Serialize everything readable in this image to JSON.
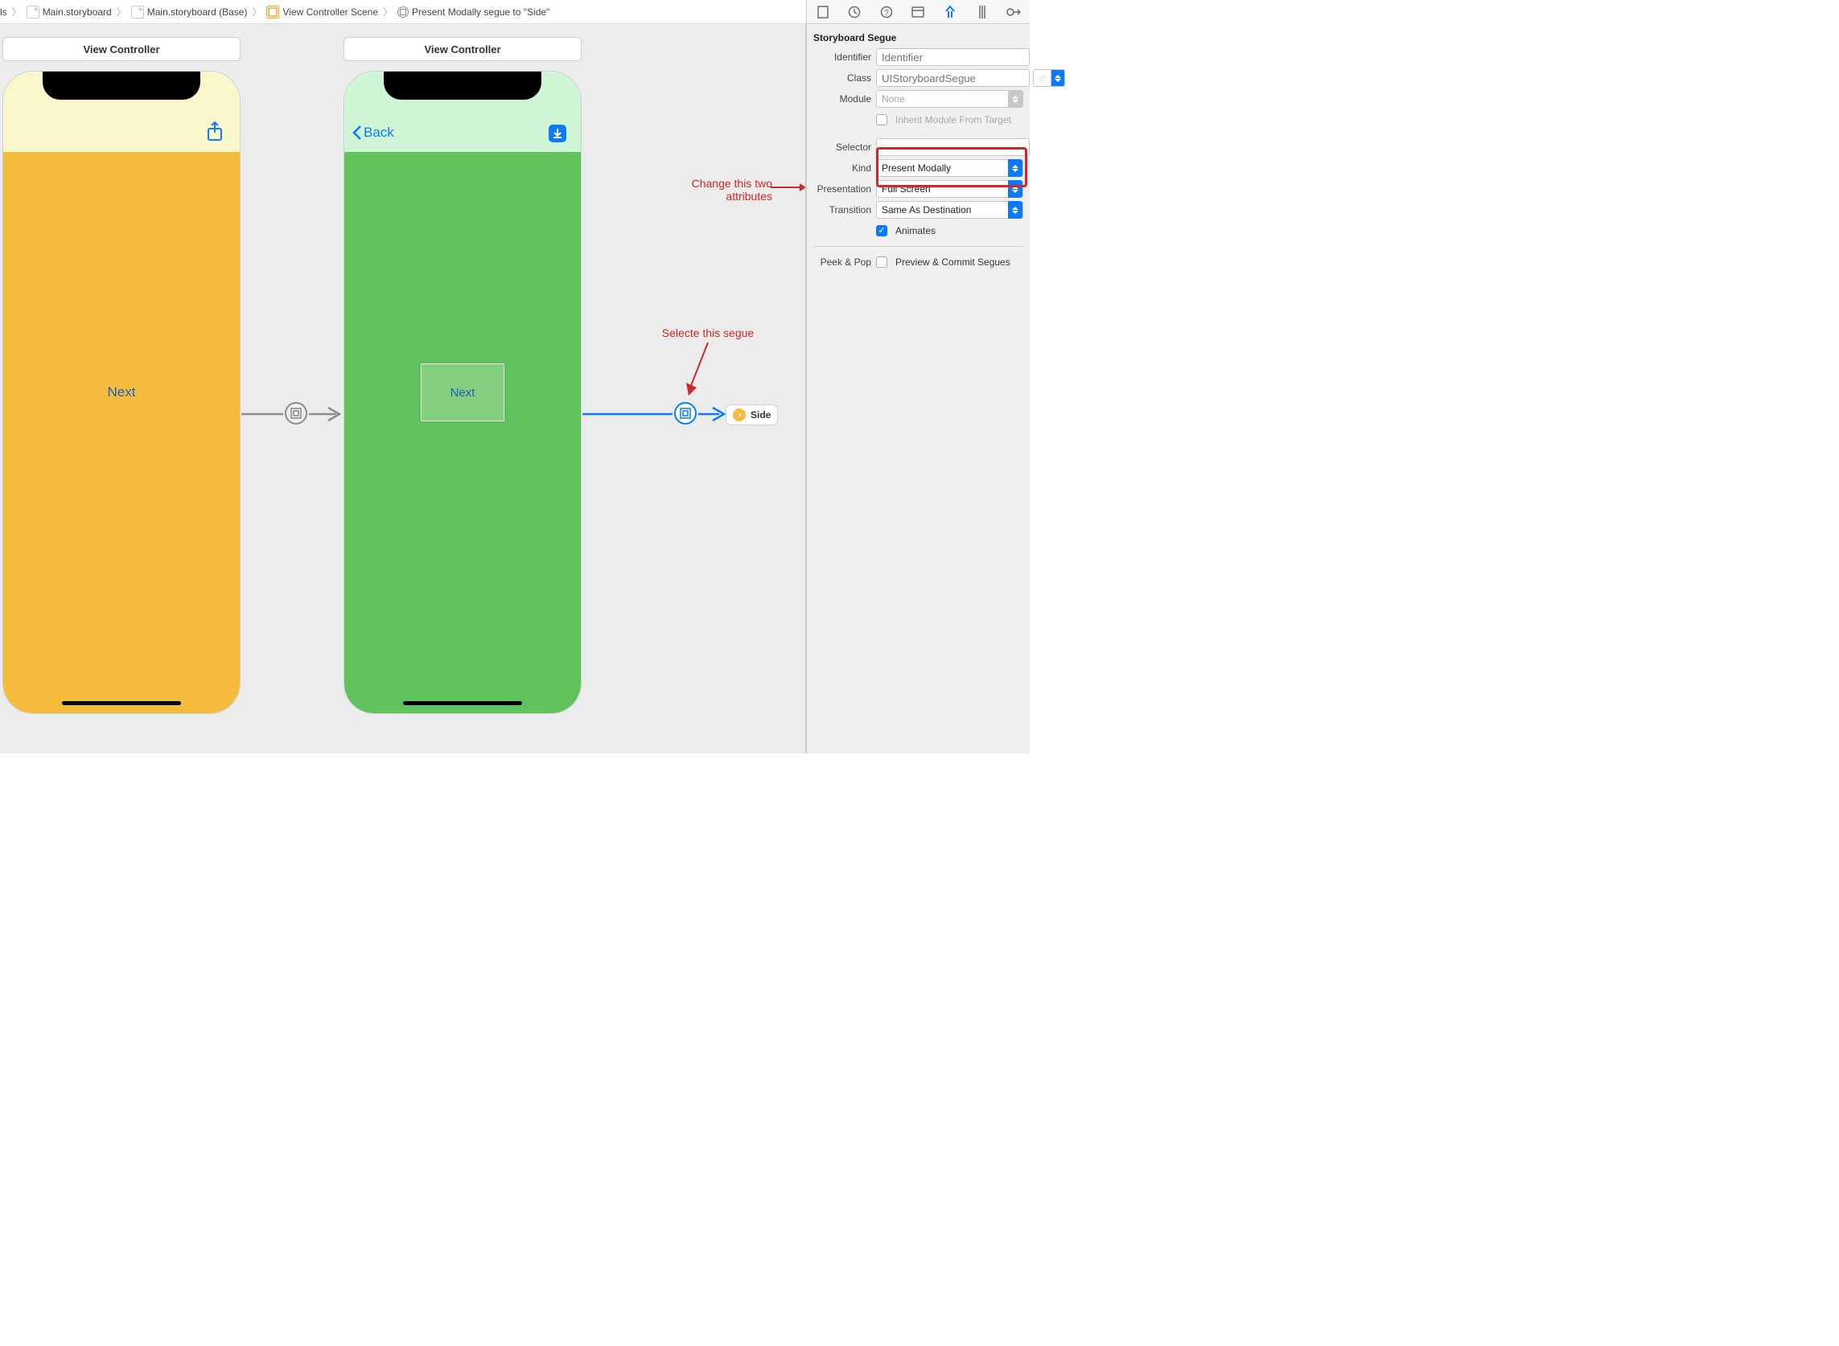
{
  "breadcrumbs": {
    "root": "ls",
    "file": "Main.storyboard",
    "base": "Main.storyboard (Base)",
    "scene": "View Controller Scene",
    "segue": "Present Modally segue to \"Side\""
  },
  "canvas": {
    "vc1": {
      "title": "View Controller",
      "button": "Next"
    },
    "vc2": {
      "title": "View Controller",
      "back": "Back",
      "container_button": "Next"
    },
    "side_badge": "Side"
  },
  "annotations": {
    "attrs_line1": "Change this two",
    "attrs_line2": "attributes",
    "segue": "Selecte this segue"
  },
  "inspector": {
    "header": "Storyboard Segue",
    "identifier_label": "Identifier",
    "identifier_ph": "Identifier",
    "class_label": "Class",
    "class_ph": "UIStoryboardSegue",
    "module_label": "Module",
    "module_value": "None",
    "inherit_label": "Inherit Module From Target",
    "selector_label": "Selector",
    "kind_label": "Kind",
    "kind_value": "Present Modally",
    "presentation_label": "Presentation",
    "presentation_value": "Full Screen",
    "transition_label": "Transition",
    "transition_value": "Same As Destination",
    "animates_label": "Animates",
    "peekpop_label": "Peek & Pop",
    "peekpop_value": "Preview & Commit Segues"
  }
}
